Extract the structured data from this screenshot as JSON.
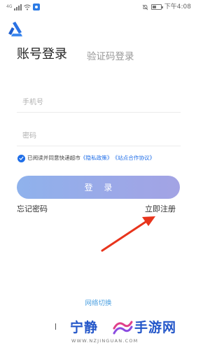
{
  "status_bar": {
    "carrier_text": "4G",
    "time": "下午4:08",
    "battery_percent": 45,
    "icons": [
      "signal-icon",
      "wifi-icon",
      "app-notification-icon",
      "mute-icon",
      "battery-icon"
    ]
  },
  "header": {
    "logo_icon": "app-logo-icon"
  },
  "tabs": {
    "account_login": "账号登录",
    "sms_login": "验证码登录"
  },
  "form": {
    "phone_placeholder": "手机号",
    "password_placeholder": "密码"
  },
  "agreement": {
    "checked": true,
    "prefix": "已阅读并同意快递超市",
    "privacy_policy": "《隐私政策》",
    "site_agreement": "《站点合作协议》"
  },
  "actions": {
    "login": "登 录",
    "forgot_password": "忘记密码",
    "register_now": "立即注册"
  },
  "footer": {
    "network_switch": "网络切换"
  },
  "watermark": {
    "left_text": "宁静",
    "right_text": "手游网",
    "url": "WWW.NZJINGUAN.COM"
  },
  "colors": {
    "accent": "#1f6ee8",
    "button_gradient_start": "#8fb2ec",
    "button_gradient_end": "#a3a3e4",
    "annotation_arrow": "#e8341c",
    "link": "#4a9fe0"
  }
}
